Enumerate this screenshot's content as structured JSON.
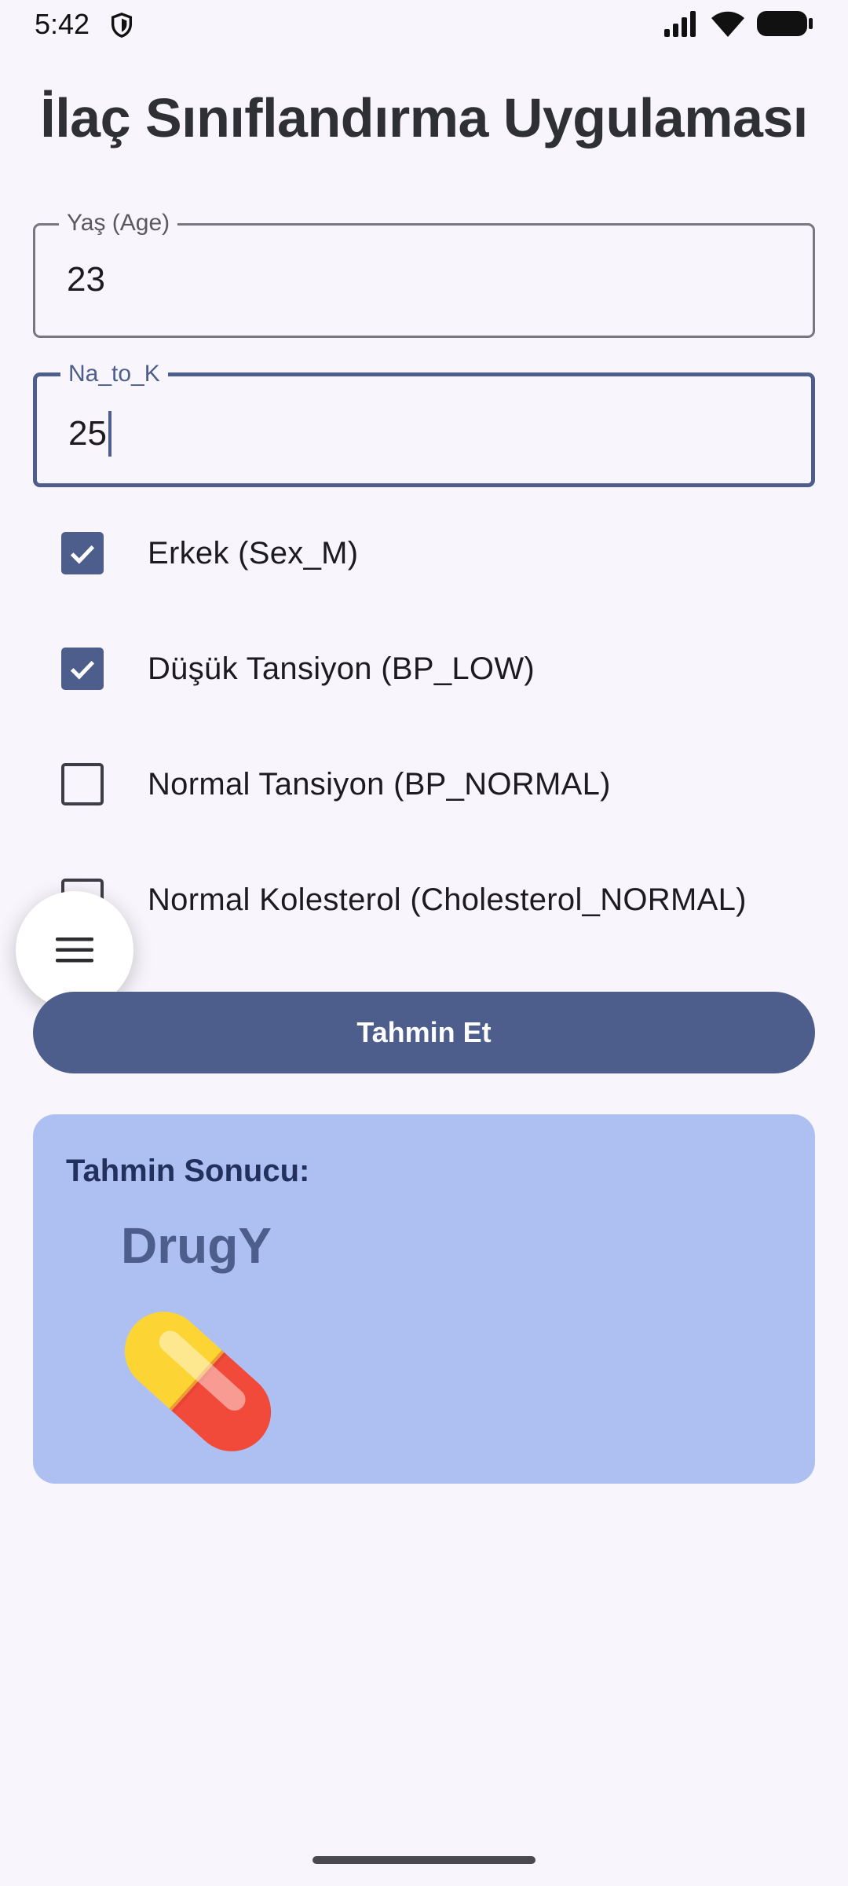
{
  "status_bar": {
    "time": "5:42",
    "icons": [
      "shield-icon",
      "signal-icon",
      "wifi-icon",
      "battery-icon"
    ]
  },
  "title": "İlaç Sınıflandırma Uygulaması",
  "fields": {
    "age": {
      "label": "Yaş (Age)",
      "value": "23"
    },
    "na_to_k": {
      "label": "Na_to_K",
      "value": "25"
    }
  },
  "checkboxes": [
    {
      "label": "Erkek (Sex_M)",
      "checked": true
    },
    {
      "label": "Düşük Tansiyon (BP_LOW)",
      "checked": true
    },
    {
      "label": "Normal Tansiyon (BP_NORMAL)",
      "checked": false
    },
    {
      "label": "Normal Kolesterol (Cholesterol_NORMAL)",
      "checked": false
    }
  ],
  "predict_button": {
    "label": "Tahmin Et"
  },
  "result": {
    "label": "Tahmin Sonucu:",
    "value": "DrugY",
    "icon": "pill-icon"
  },
  "colors": {
    "primary": "#4d5e8c",
    "result_card": "#aec0f2",
    "background": "#f8f6fc"
  }
}
